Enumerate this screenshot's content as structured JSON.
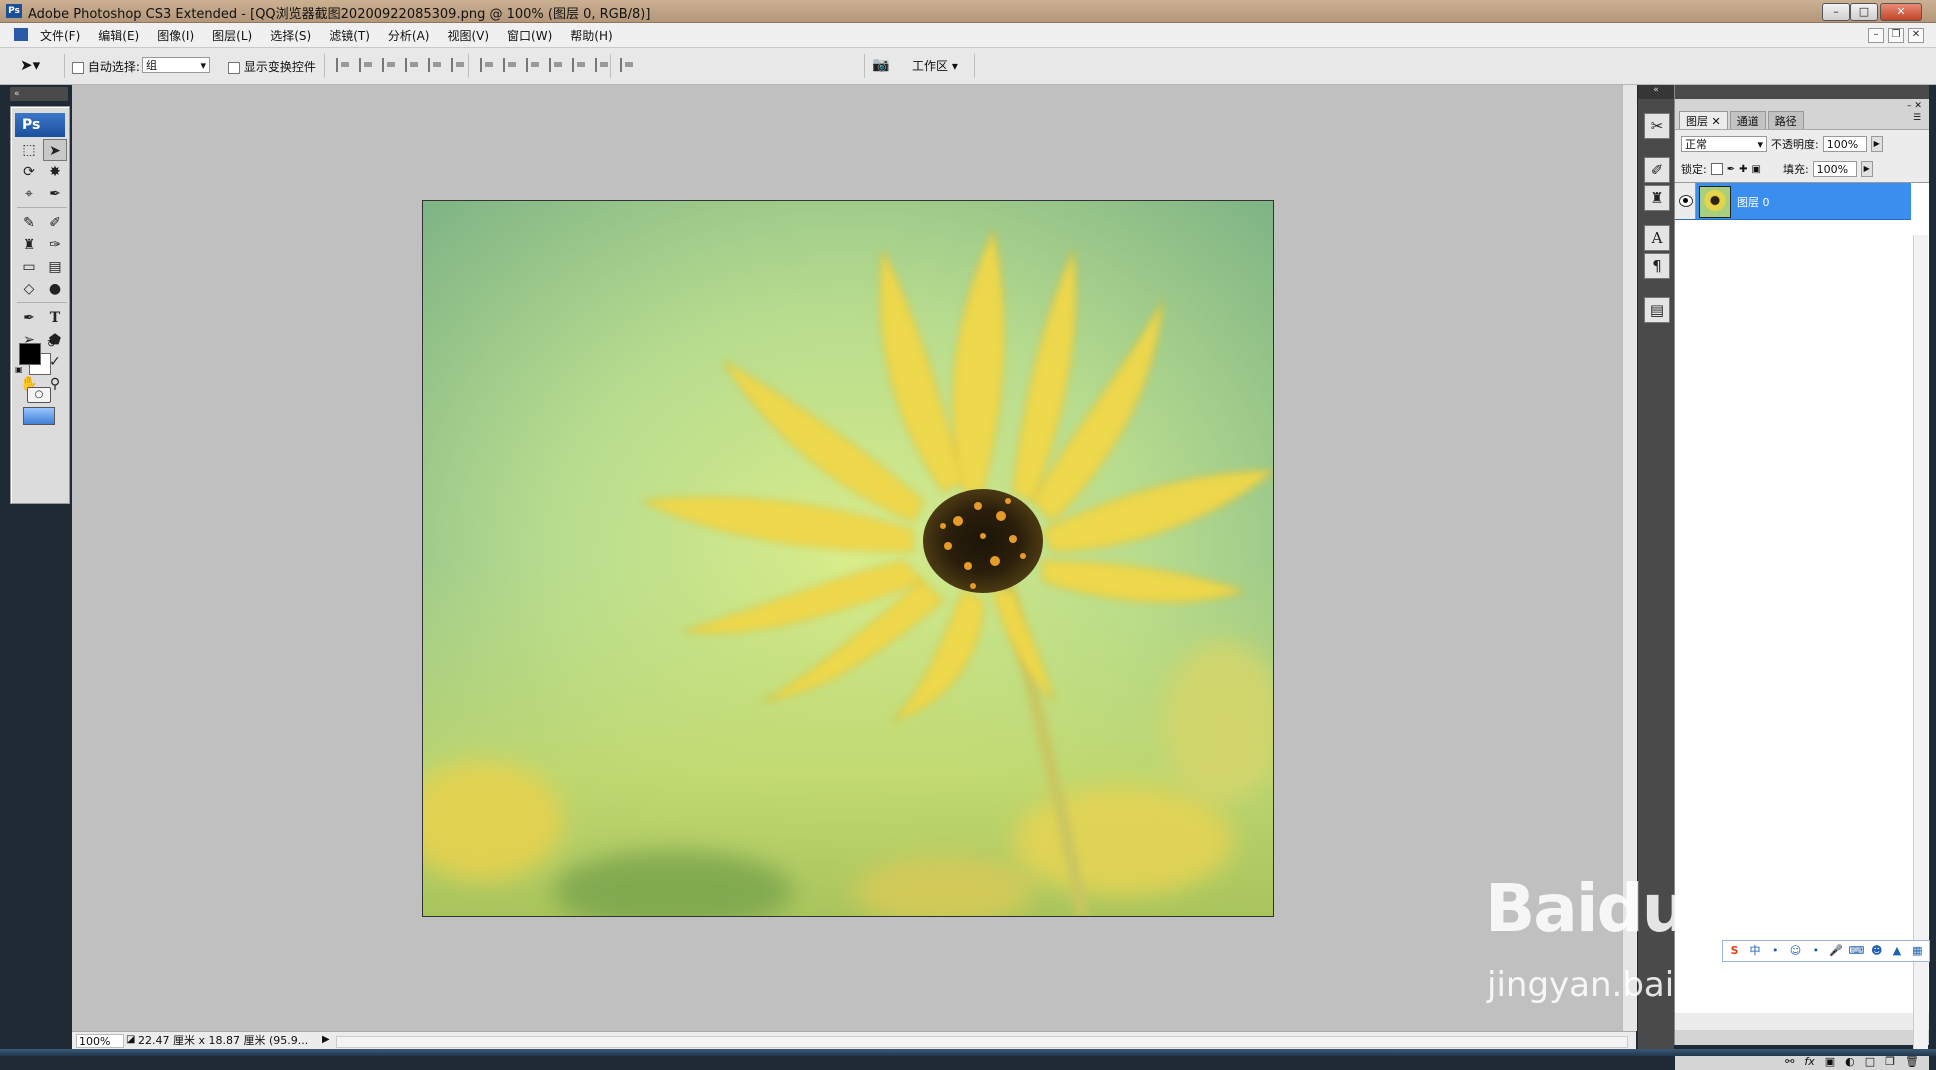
{
  "window": {
    "title": "Adobe Photoshop CS3 Extended - [QQ浏览器截图20200922085309.png @ 100% (图层 0, RGB/8)]",
    "app_icon": "Ps",
    "controls": [
      "minimize",
      "maximize",
      "close"
    ]
  },
  "menu": {
    "items": [
      "文件(F)",
      "编辑(E)",
      "图像(I)",
      "图层(L)",
      "选择(S)",
      "滤镜(T)",
      "分析(A)",
      "视图(V)",
      "窗口(W)",
      "帮助(H)"
    ]
  },
  "options_bar": {
    "auto_select_label": "自动选择:",
    "auto_select_value": "组",
    "show_transform_label": "显示变换控件",
    "workspace_label": "工作区"
  },
  "toolbox": {
    "badge": "Ps"
  },
  "statusbar": {
    "zoom": "100%",
    "doc_info": "22.47 厘米 x 18.87 厘米 (95.9..."
  },
  "layers_panel": {
    "tabs": [
      "图层",
      "通道",
      "路径"
    ],
    "blend_mode": "正常",
    "opacity_label": "不透明度:",
    "opacity_value": "100%",
    "lock_label": "锁定:",
    "fill_label": "填充:",
    "fill_value": "100%",
    "layers": [
      {
        "name": "图层 0",
        "visible": true,
        "selected": true
      }
    ],
    "footer_icons": [
      "link-icon",
      "fx-icon",
      "mask-icon",
      "adjustment-icon",
      "group-icon",
      "new-layer-icon",
      "trash-icon"
    ]
  },
  "dock": {
    "buttons": [
      "tools-preset-icon",
      "brushes-icon",
      "clone-source-icon",
      "character-icon",
      "paragraph-icon",
      "layer-comps-icon"
    ]
  },
  "ime_toolbar": {
    "items": [
      "S",
      "中",
      "•",
      "☺",
      "•",
      "mic",
      "kbd",
      "user",
      "shirt",
      "grid"
    ]
  },
  "watermark": {
    "line1": "Baidu 经验",
    "line2": "jingyan.baidu.com"
  },
  "colors": {
    "selection_blue": "#3a8eee",
    "canvas_bg": "#c0c0c0",
    "title_bar": "#b5977a"
  }
}
